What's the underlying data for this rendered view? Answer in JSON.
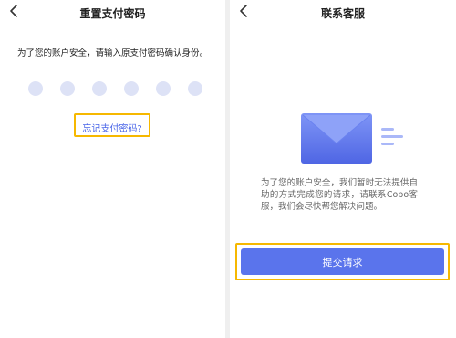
{
  "left_screen": {
    "title": "重置支付密码",
    "notice": "为了您的账户安全，请输入原支付密码确认身份。",
    "pin_digits": 6,
    "forgot_link": "忘记支付密码?"
  },
  "right_screen": {
    "title": "联系客服",
    "description": "为了您的账户安全，我们暂时无法提供自助的方式完成您的请求，请联系Cobo客服，我们会尽快帮您解决问题。",
    "submit_label": "提交请求"
  },
  "colors": {
    "accent": "#5a74ec",
    "link": "#4a66e8",
    "highlight": "#f6b800",
    "pin_dot": "#dde2f6"
  },
  "icons": [
    "back-chevron-icon",
    "envelope-icon"
  ]
}
